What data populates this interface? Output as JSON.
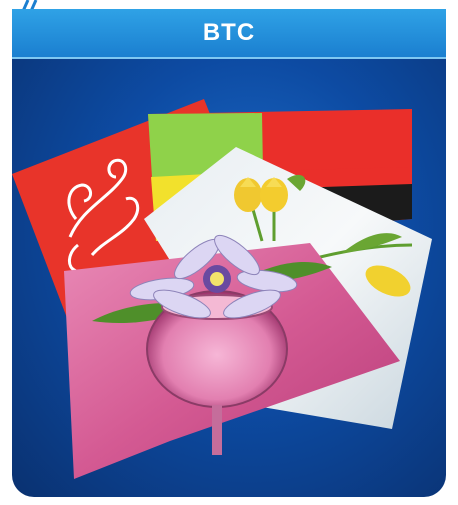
{
  "header": {
    "title": "BTC"
  },
  "colors": {
    "header_blue": "#1b7fd0",
    "panel_blue": "#0d4ba3",
    "sheet_red": "#e8342a",
    "sheet_green": "#8fd24a",
    "sheet_yellow": "#f2e12c",
    "sheet_pink": "#d65f97"
  },
  "icons": [
    "swirl-ornament-icon",
    "tulip-icon",
    "flower-vase-icon"
  ]
}
